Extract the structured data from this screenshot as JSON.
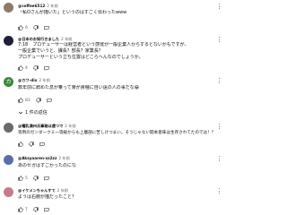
{
  "comments": [
    {
      "handle": "@coffee6512",
      "time": "2 年前",
      "lines": [
        "「私Oさんが描いた」というのはすごく伝わったwww"
      ],
      "likes": "6",
      "avatar_color": "#8d7a6a"
    },
    {
      "handle": "@日本のお知行きました",
      "time": "2 年前",
      "lines": [
        "7:18　プロデューサーは経営者という感覚が一般企業人からするとないかもですが、",
        "一般企業でいうと、課長？部長？家業長？",
        "プロデューサーという立ち位置はどこらへんなのでしょうか。"
      ],
      "likes": "4",
      "avatar_color": "#1f1f3a"
    },
    {
      "handle": "@カワ-dix",
      "time": "2 年前",
      "lines": [
        "数年前に辞めた息が乗って楽が貴種に自い遠の人の事だな😀"
      ],
      "likes": "83",
      "avatar_color": "#3a8a3a",
      "avatar_letter": "カ"
    },
    {
      "handle": "@糟乳満州氏事務は遠つで",
      "time": "2 年前",
      "lines": [
        "等例のガンダークミ一等級からも上層部に苦しけつまい。そうじゃない開本意味は生存されてたのでは！？"
      ],
      "likes": "",
      "avatar_color": "#6a6a6a"
    },
    {
      "handle": "@Aksyaaren-sz2zz",
      "time": "2 年前",
      "lines": [
        "あのセガはすごかったのにな"
      ],
      "likes": "5",
      "avatar_color": "#5a6fa8"
    },
    {
      "handle": "@イケメンちゃんすて",
      "time": "2 年前",
      "lines": [
        "ようは右腕が描だったこと？"
      ],
      "likes": "7",
      "avatar_color": "#c77b8a"
    }
  ],
  "replies_label": "1 件の返信",
  "icons": {
    "like": "thumbs-up-icon",
    "dislike": "thumbs-down-icon",
    "reply": "reply-icon",
    "more": "more-vert-icon",
    "expand": "chevron-down-icon"
  }
}
